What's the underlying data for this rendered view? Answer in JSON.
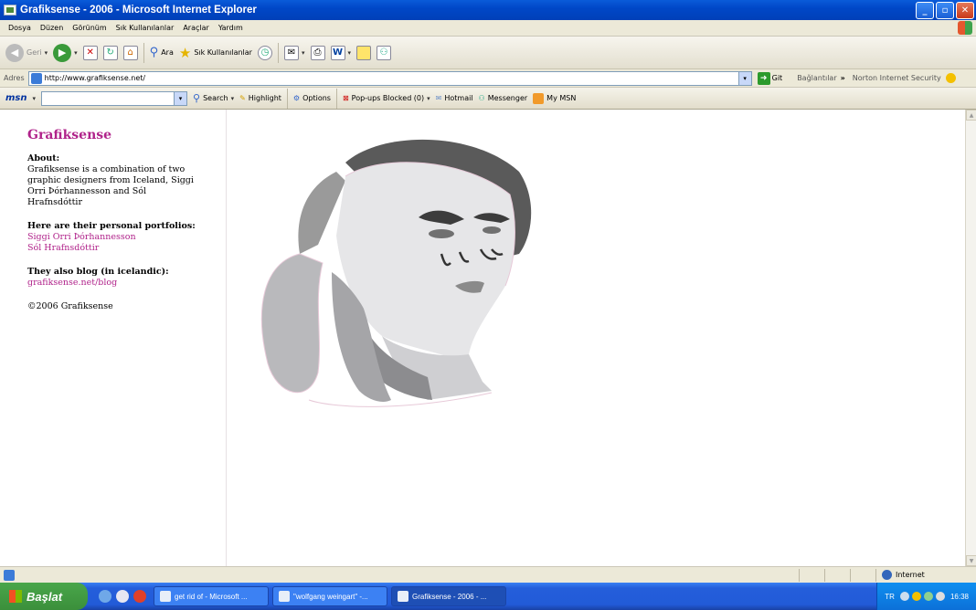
{
  "window": {
    "title": "Grafiksense - 2006 - Microsoft Internet Explorer",
    "min": "_",
    "max": "▫",
    "close": "✕"
  },
  "menu": [
    "Dosya",
    "Düzen",
    "Görünüm",
    "Sık Kullanılanlar",
    "Araçlar",
    "Yardım"
  ],
  "toolbar": {
    "back": "Geri",
    "search": "Ara",
    "favorites": "Sık Kullanılanlar"
  },
  "address": {
    "label": "Adres",
    "url": "http://www.grafiksense.net/",
    "go": "Git",
    "links": "Bağlantılar",
    "chevron": "»",
    "norton": "Norton Internet Security"
  },
  "msn": {
    "logo": "msn",
    "search": "Search",
    "highlight": "Highlight",
    "options": "Options",
    "popups": "Pop-ups Blocked (0)",
    "hotmail": "Hotmail",
    "messenger": "Messenger",
    "mymsn": "My MSN"
  },
  "page": {
    "title": "Grafiksense",
    "about_heading": "About:",
    "about_text": "Grafiksense is a combination of two graphic designers from Iceland, Siggi Orri Þórhannesson and Sól Hrafnsdóttir",
    "portfolios_heading": "Here are their personal portfolios:",
    "portfolio_1": "Siggi Orri Þórhannesson",
    "portfolio_2": "Sól Hrafnsdóttir",
    "blog_heading": "They also blog (in icelandic):",
    "blog_link": "grafiksense.net/blog",
    "copyright": "©2006 Grafiksense"
  },
  "status": {
    "zone": "Internet"
  },
  "taskbar": {
    "start": "Başlat",
    "tasks": [
      "get rid of - Microsoft ...",
      "\"wolfgang weingart\" -...",
      "Grafiksense - 2006 - ..."
    ],
    "lang": "TR",
    "time": "16:38"
  }
}
